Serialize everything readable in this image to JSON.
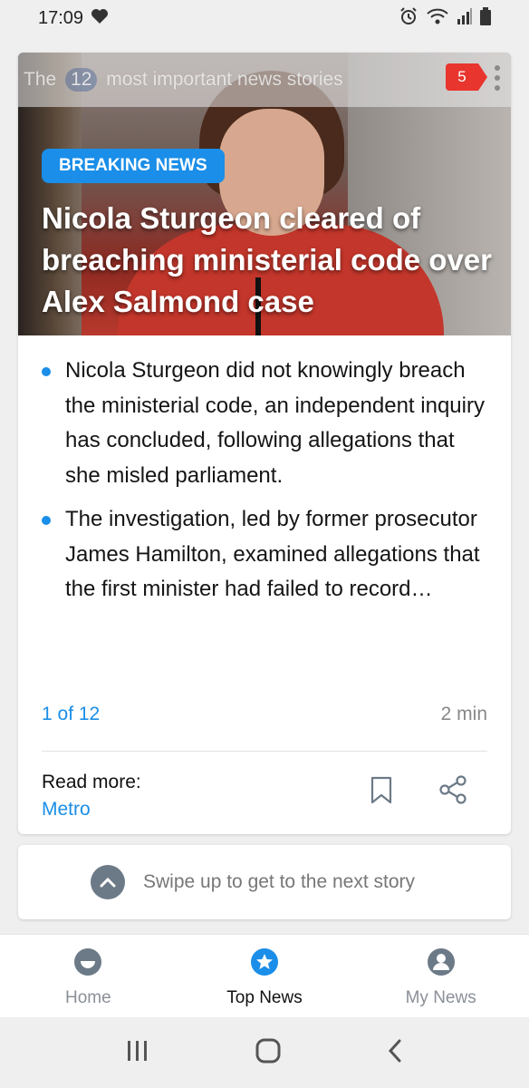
{
  "status_bar": {
    "time": "17:09"
  },
  "story": {
    "topbar_prefix": "The",
    "topbar_count": "12",
    "topbar_suffix": "most important news stories",
    "badge_count": "5",
    "tag": "BREAKING NEWS",
    "headline": "Nicola Sturgeon cleared of breaching ministerial code over Alex Salmond case",
    "bullets": [
      "Nicola Sturgeon did not knowingly breach the ministerial code, an independent inquiry has concluded, following allegations that she misled parliament.",
      "The investigation, led by former prosecutor James Hamilton, examined allegations that the first minister had failed to record…"
    ],
    "position": "1 of 12",
    "read_time": "2 min",
    "read_more_label": "Read more:",
    "source": "Metro"
  },
  "swipe_hint": "Swipe up to get to the next story",
  "bottom_nav": [
    {
      "label": "Home",
      "icon": "smiley-icon"
    },
    {
      "label": "Top News",
      "icon": "star-icon"
    },
    {
      "label": "My News",
      "icon": "person-icon"
    }
  ],
  "colors": {
    "accent": "#1a8ee8",
    "badge": "#e8352d"
  }
}
